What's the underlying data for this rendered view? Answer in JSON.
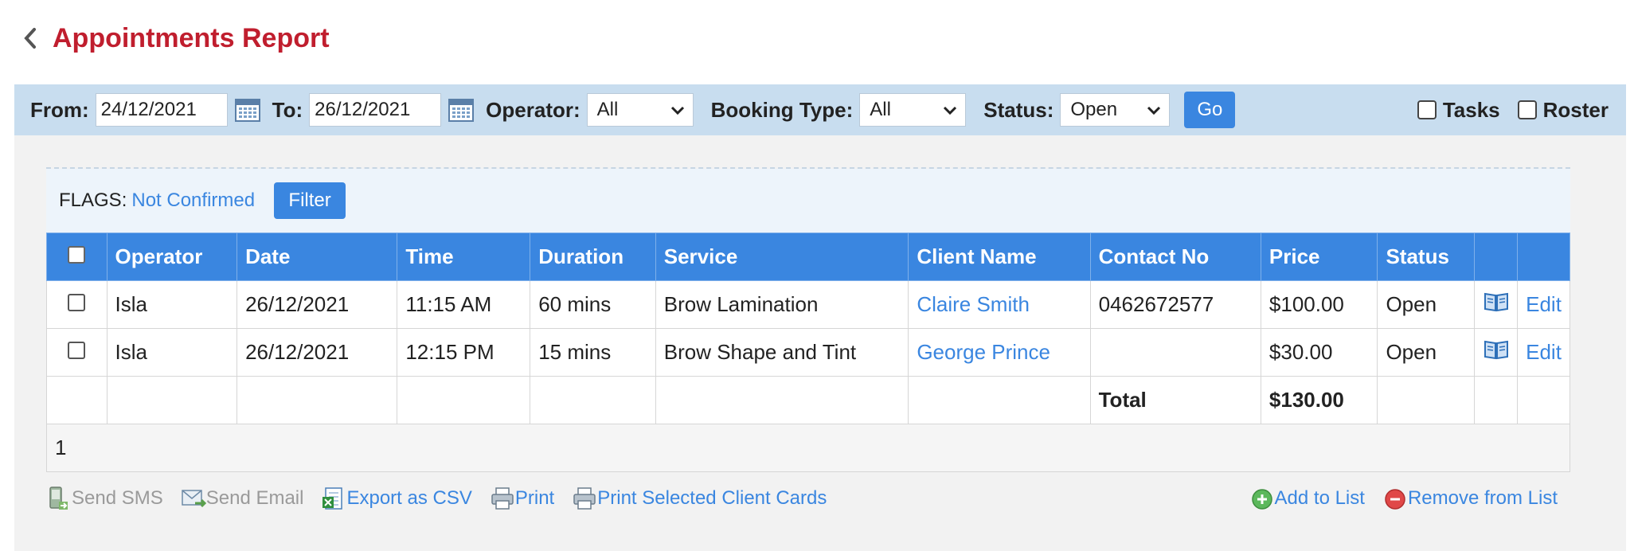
{
  "header": {
    "title": "Appointments Report"
  },
  "filters": {
    "from_label": "From:",
    "from_value": "24/12/2021",
    "to_label": "To:",
    "to_value": "26/12/2021",
    "operator_label": "Operator:",
    "operator_value": "All",
    "booking_type_label": "Booking Type:",
    "booking_type_value": "All",
    "status_label": "Status:",
    "status_value": "Open",
    "go_label": "Go",
    "tasks_label": "Tasks",
    "roster_label": "Roster"
  },
  "flags": {
    "label": "FLAGS:",
    "link": "Not Confirmed",
    "filter_label": "Filter"
  },
  "table": {
    "headers": [
      "Operator",
      "Date",
      "Time",
      "Duration",
      "Service",
      "Client Name",
      "Contact No",
      "Price",
      "Status"
    ],
    "rows": [
      {
        "operator": "Isla",
        "date": "26/12/2021",
        "time": "11:15 AM",
        "duration": "60 mins",
        "service": "Brow Lamination",
        "client": "Claire Smith",
        "contact": "0462672577",
        "price": "$100.00",
        "status": "Open",
        "edit": "Edit"
      },
      {
        "operator": "Isla",
        "date": "26/12/2021",
        "time": "12:15 PM",
        "duration": "15 mins",
        "service": "Brow Shape and Tint",
        "client": "George Prince",
        "contact": "",
        "price": "$30.00",
        "status": "Open",
        "edit": "Edit"
      }
    ],
    "total_label": "Total",
    "total_value": "$130.00",
    "page": "1"
  },
  "actions": {
    "send_sms": "Send SMS",
    "send_email": "Send Email",
    "export_csv": "Export as CSV",
    "print": "Print",
    "print_cards": "Print Selected Client Cards",
    "add_to_list": "Add to List",
    "remove_from_list": "Remove from List"
  },
  "colors": {
    "title_red": "#c01e2e",
    "accent_blue": "#3a86e0",
    "filter_bar_bg": "#c8ddef"
  }
}
